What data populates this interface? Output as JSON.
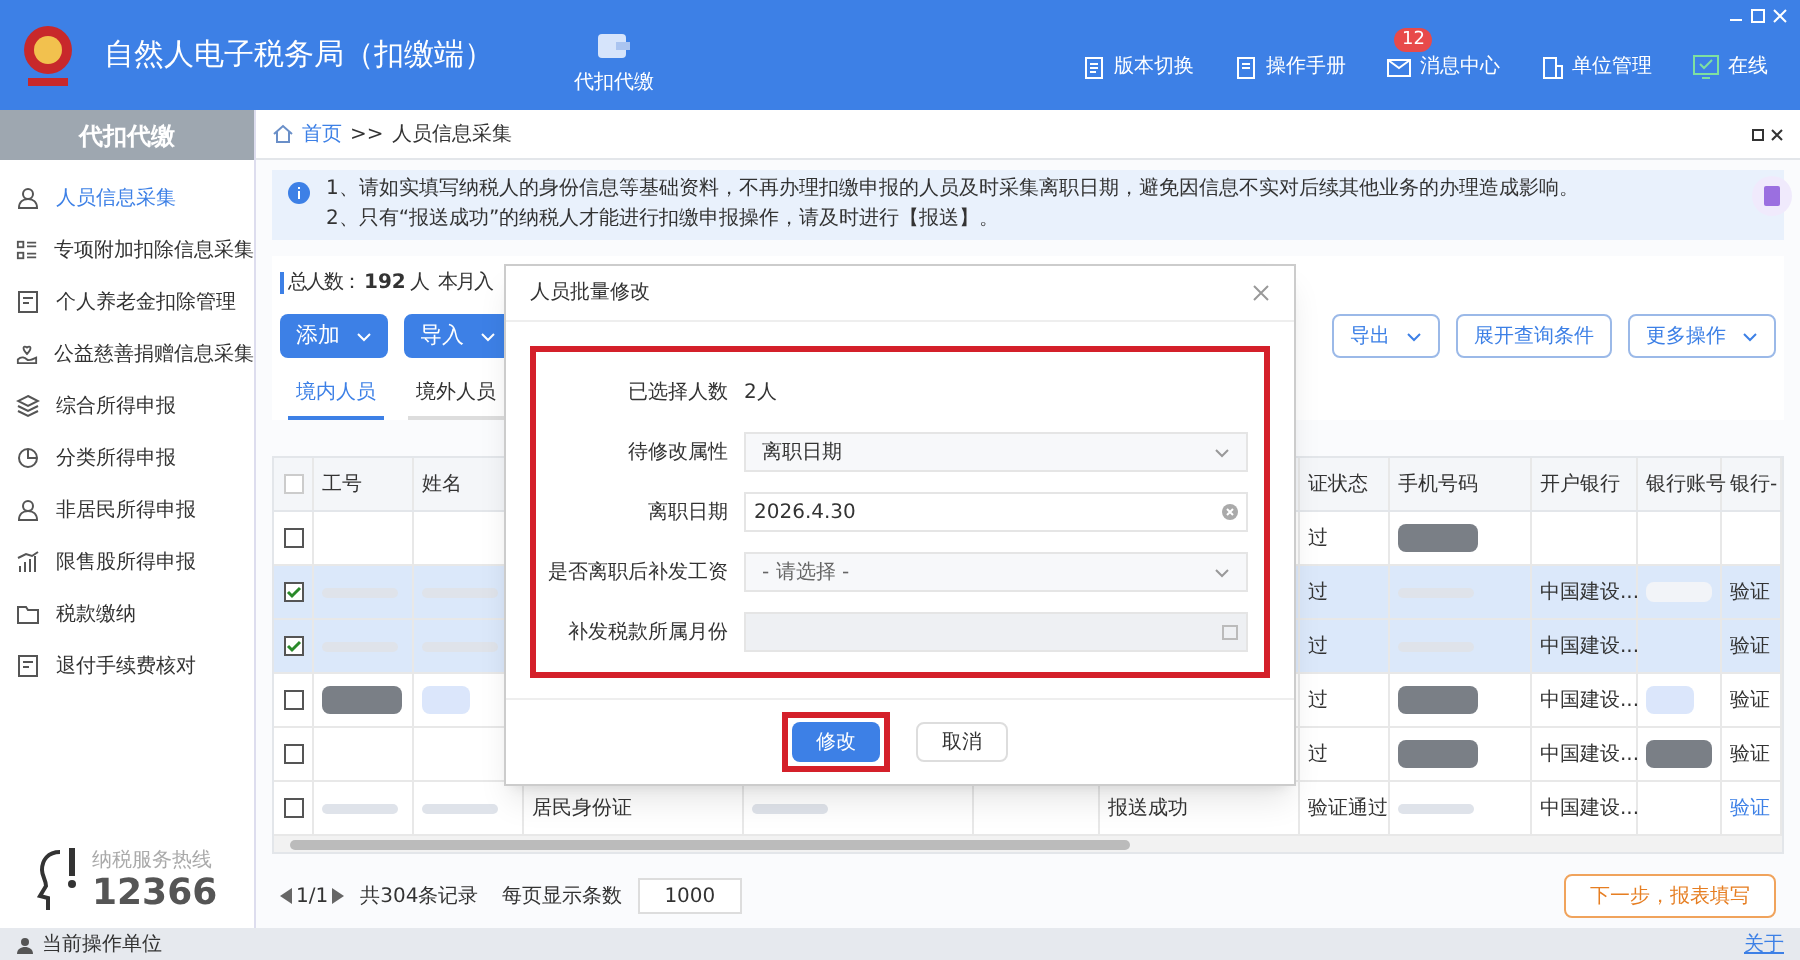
{
  "window": {
    "title": "自然人电子税务局（扣缴端）"
  },
  "header": {
    "center_item": "代扣代缴",
    "items": [
      {
        "kind": "version",
        "label": "版本切换"
      },
      {
        "kind": "manual",
        "label": "操作手册"
      },
      {
        "kind": "message",
        "label": "消息中心",
        "badge": "12"
      },
      {
        "kind": "unit",
        "label": "单位管理"
      },
      {
        "kind": "online",
        "label": "在线"
      }
    ]
  },
  "sidebar": {
    "title": "代扣代缴",
    "items": [
      {
        "kind": "person",
        "label": "人员信息采集",
        "selected": true
      },
      {
        "kind": "list",
        "label": "专项附加扣除信息采集",
        "selected": false
      },
      {
        "kind": "doc",
        "label": "个人养老金扣除管理",
        "selected": false
      },
      {
        "kind": "heart",
        "label": "公益慈善捐赠信息采集",
        "selected": false
      },
      {
        "kind": "layers",
        "label": "综合所得申报",
        "selected": false
      },
      {
        "kind": "pie",
        "label": "分类所得申报",
        "selected": false
      },
      {
        "kind": "person",
        "label": "非居民所得申报",
        "selected": false
      },
      {
        "kind": "chart",
        "label": "限售股所得申报",
        "selected": false
      },
      {
        "kind": "folder",
        "label": "税款缴纳",
        "selected": false
      },
      {
        "kind": "doc",
        "label": "退付手续费核对",
        "selected": false
      }
    ],
    "hotline_label": "纳税服务热线",
    "hotline": "12366"
  },
  "breadcrumb": {
    "home": "首页",
    "separator": ">>",
    "current": "人员信息采集"
  },
  "notice": [
    "1、请如实填写纳税人的身份信息等基础资料，不再办理扣缴申报的人员及时采集离职日期，避免因信息不实对后续其他业务的办理造成影响。",
    "2、只有“报送成功”的纳税人才能进行扣缴申报操作，请及时进行【报送】。"
  ],
  "summary": {
    "label": "总人数：",
    "count": "192",
    "unit": "人",
    "extra": "本月入"
  },
  "toolbar": {
    "left": [
      {
        "label": "添加",
        "dropdown": true
      },
      {
        "label": "导入",
        "dropdown": true
      }
    ],
    "right": [
      {
        "label": "导出",
        "dropdown": true
      },
      {
        "label": "展开查询条件",
        "dropdown": false
      },
      {
        "label": "更多操作",
        "dropdown": true
      }
    ]
  },
  "tabs": [
    {
      "label": "境内人员",
      "selected": true
    },
    {
      "label": "境外人员",
      "selected": false
    }
  ],
  "table": {
    "header_checked": false,
    "columns": [
      "工号",
      "姓名",
      null,
      null,
      null,
      null,
      "证状态",
      "手机号码",
      "开户银行",
      "银行账号",
      "银行-"
    ],
    "rows": [
      {
        "selected": false,
        "cells": [
          null,
          null,
          null,
          null,
          null,
          null,
          {
            "text": "过"
          },
          {
            "kind": "redacted_dark"
          },
          null,
          null,
          null
        ]
      },
      {
        "selected": true,
        "cells": [
          {
            "kind": "redacted_light"
          },
          {
            "kind": "redacted_light"
          },
          null,
          null,
          null,
          null,
          {
            "text": "过"
          },
          {
            "kind": "redacted_light"
          },
          {
            "text": "中国建设..."
          },
          {
            "kind": "redacted_white"
          },
          {
            "text": "验证"
          }
        ]
      },
      {
        "selected": true,
        "cells": [
          {
            "kind": "redacted_light"
          },
          {
            "kind": "redacted_light"
          },
          null,
          null,
          null,
          null,
          {
            "text": "过"
          },
          {
            "kind": "redacted_light"
          },
          {
            "text": "中国建设..."
          },
          null,
          {
            "text": "验证"
          }
        ]
      },
      {
        "selected": false,
        "cells": [
          {
            "kind": "redacted_dark"
          },
          {
            "kind": "redacted_blue"
          },
          null,
          null,
          null,
          null,
          {
            "text": "过"
          },
          {
            "kind": "redacted_dark"
          },
          {
            "text": "中国建设..."
          },
          {
            "kind": "redacted_blue"
          },
          {
            "text": "验证"
          }
        ]
      },
      {
        "selected": false,
        "cells": [
          null,
          null,
          null,
          null,
          null,
          null,
          {
            "text": "过"
          },
          {
            "kind": "redacted_dark"
          },
          {
            "text": "中国建设..."
          },
          {
            "kind": "redacted_dark"
          },
          {
            "text": "验证"
          }
        ]
      },
      {
        "selected": false,
        "cells": [
          {
            "kind": "redacted_light"
          },
          {
            "kind": "redacted_light"
          },
          {
            "text": "居民身份证"
          },
          {
            "kind": "redacted_light"
          },
          null,
          {
            "text": "报送成功"
          },
          {
            "text": "验证通过"
          },
          {
            "kind": "redacted_light"
          },
          {
            "text": "中国建设..."
          },
          null,
          {
            "text": "验证",
            "link": true
          }
        ]
      }
    ]
  },
  "pagination": {
    "page": "1/1",
    "total": "共304条记录",
    "per_page_label": "每页显示条数",
    "per_page": "1000"
  },
  "next_button": "下一步，报表填写",
  "status_bar": {
    "label": "当前操作单位",
    "about": "关于"
  },
  "modal": {
    "title": "人员批量修改",
    "highlighted": true,
    "fields": [
      {
        "kind": "text",
        "label": "已选择人数",
        "value": "2人"
      },
      {
        "kind": "select",
        "label": "待修改属性",
        "value": "离职日期"
      },
      {
        "kind": "date",
        "label": "离职日期",
        "value": "2026.4.30"
      },
      {
        "kind": "select",
        "label": "是否离职后补发工资",
        "placeholder": "- 请选择 -"
      },
      {
        "kind": "month",
        "label": "补发税款所属月份",
        "disabled": true
      }
    ],
    "buttons": [
      {
        "label": "修改",
        "primary": true,
        "highlighted": true
      },
      {
        "label": "取消",
        "primary": false,
        "highlighted": false
      }
    ]
  }
}
